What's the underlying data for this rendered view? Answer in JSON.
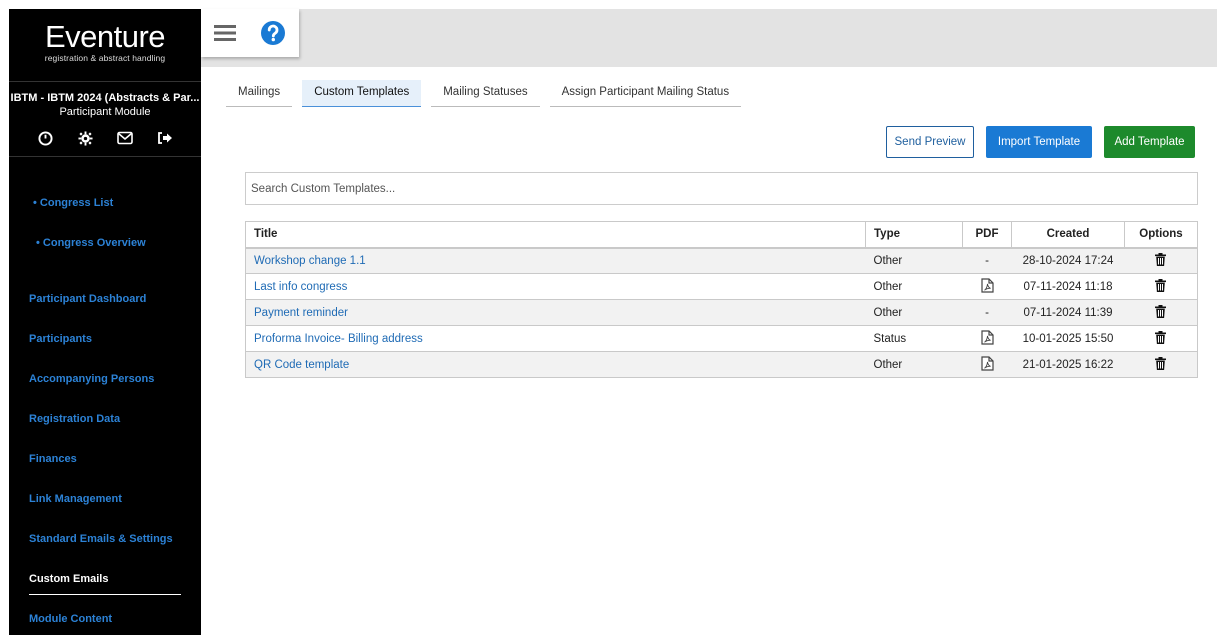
{
  "brand": {
    "logo_main": "Eventure",
    "logo_sub": "registration & abstract handling"
  },
  "sidebar": {
    "congress_name": "IBTM - IBTM 2024 (Abstracts & Par...",
    "module_name": "Participant Module",
    "icons": [
      "clock-icon",
      "gear-icon",
      "mail-icon",
      "logout-icon"
    ],
    "sub_items": [
      "• Congress List",
      "• Congress Overview"
    ],
    "items": [
      {
        "label": "Participant Dashboard"
      },
      {
        "label": "Participants"
      },
      {
        "label": "Accompanying Persons"
      },
      {
        "label": "Registration Data"
      },
      {
        "label": "Finances"
      },
      {
        "label": "Link Management"
      },
      {
        "label": "Standard Emails & Settings"
      },
      {
        "label": "Custom Emails"
      },
      {
        "label": "Module Content"
      }
    ],
    "active_item": "Custom Emails"
  },
  "topbar": {
    "icons": [
      "menu-icon",
      "help-icon"
    ]
  },
  "tabs": [
    {
      "label": "Mailings"
    },
    {
      "label": "Custom Templates"
    },
    {
      "label": "Mailing Statuses"
    },
    {
      "label": "Assign Participant Mailing Status"
    }
  ],
  "active_tab": "Custom Templates",
  "actions": {
    "send_preview": "Send Preview",
    "import_template": "Import Template",
    "add_template": "Add Template"
  },
  "search": {
    "placeholder": "Search Custom Templates...",
    "value": ""
  },
  "table": {
    "headers": {
      "title": "Title",
      "type": "Type",
      "pdf": "PDF",
      "created": "Created",
      "options": "Options"
    },
    "rows": [
      {
        "title": "Workshop change 1.1",
        "type": "Other",
        "pdf": "-",
        "has_pdf": false,
        "created": "28-10-2024 17:24"
      },
      {
        "title": "Last info congress",
        "type": "Other",
        "pdf": "",
        "has_pdf": true,
        "created": "07-11-2024 11:18"
      },
      {
        "title": "Payment reminder",
        "type": "Other",
        "pdf": "-",
        "has_pdf": false,
        "created": "07-11-2024 11:39"
      },
      {
        "title": "Proforma Invoice- Billing address",
        "type": "Status",
        "pdf": "",
        "has_pdf": true,
        "created": "10-01-2025 15:50"
      },
      {
        "title": "QR Code template",
        "type": "Other",
        "pdf": "",
        "has_pdf": true,
        "created": "21-01-2025 16:22"
      }
    ]
  },
  "colors": {
    "sidebar_bg": "#000000",
    "nav_link": "#2c82d6",
    "primary": "#1a7ad4",
    "success": "#1d8a2c",
    "link": "#1f6bb5"
  }
}
